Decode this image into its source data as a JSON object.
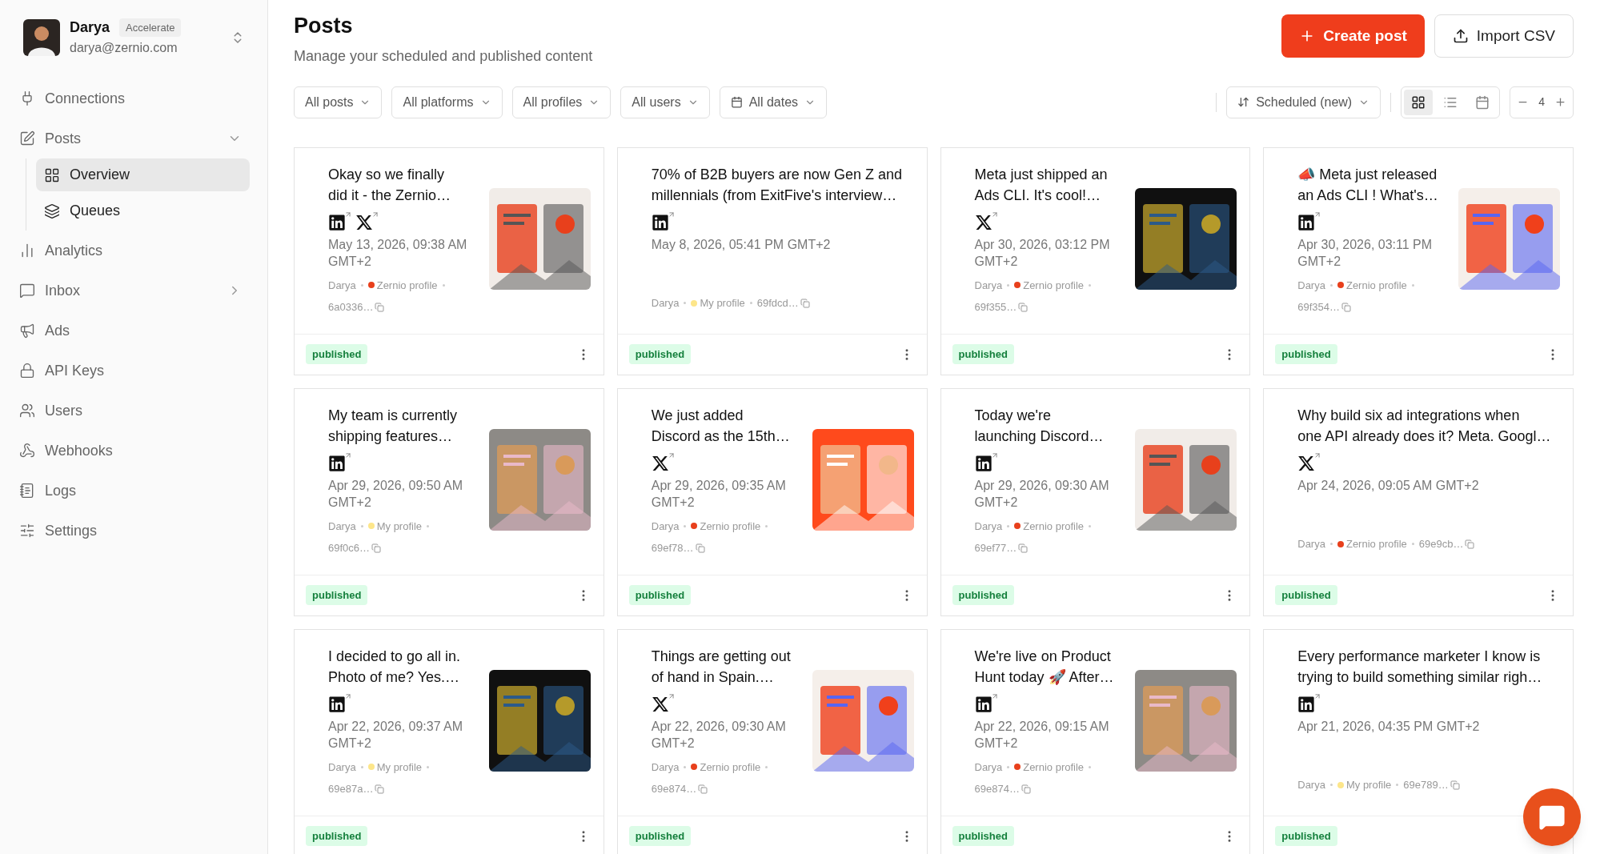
{
  "account": {
    "name": "Darya",
    "plan": "Accelerate",
    "email": "darya@zernio.com"
  },
  "sidebar": {
    "items": [
      {
        "kind": "link",
        "label": "Connections",
        "selected": false
      },
      {
        "kind": "group",
        "label": "Posts",
        "selected": false,
        "expanded": true,
        "children": [
          {
            "label": "Overview",
            "selected": true
          },
          {
            "label": "Queues",
            "selected": false
          }
        ]
      },
      {
        "kind": "link",
        "label": "Analytics",
        "selected": false
      },
      {
        "kind": "group",
        "label": "Inbox",
        "selected": false,
        "expanded": false
      },
      {
        "kind": "link",
        "label": "Ads",
        "selected": false
      },
      {
        "kind": "link",
        "label": "API Keys",
        "selected": false
      },
      {
        "kind": "link",
        "label": "Users",
        "selected": false
      },
      {
        "kind": "link",
        "label": "Webhooks",
        "selected": false
      },
      {
        "kind": "link",
        "label": "Logs",
        "selected": false
      },
      {
        "kind": "link",
        "label": "Settings",
        "selected": false
      }
    ]
  },
  "header": {
    "title": "Posts",
    "subtitle": "Manage your scheduled and published content",
    "primary_button": "Create post",
    "secondary_button": "Import CSV"
  },
  "filters": [
    {
      "kind": "plain",
      "label": "All posts"
    },
    {
      "kind": "plain",
      "label": "All platforms"
    },
    {
      "kind": "plain",
      "label": "All profiles"
    },
    {
      "kind": "plain",
      "label": "All users"
    },
    {
      "kind": "date",
      "label": "All dates"
    }
  ],
  "sort": {
    "label": "Scheduled (new)"
  },
  "views": [
    {
      "kind": "grid",
      "selected": true
    },
    {
      "kind": "list",
      "selected": false
    },
    {
      "kind": "calendar",
      "selected": false
    }
  ],
  "columns": {
    "value": "4"
  },
  "posts": [
    {
      "title": "Okay so we finally\ndid it - the Zernio…",
      "platforms": [
        {
          "kind": "linkedin"
        },
        {
          "kind": "x"
        }
      ],
      "date": "May 13, 2026, 09:38 AM GMT+2",
      "user": "Darya",
      "profile": "Zernio profile",
      "color": "#e8401c",
      "id": "6a0336…",
      "thumbnail": {
        "kind": "picture"
      },
      "status": "published"
    },
    {
      "title": "70% of B2B buyers are now Gen Z and\nmillennials (from ExitFive's interview…",
      "platforms": [
        {
          "kind": "linkedin"
        }
      ],
      "date": "May 8, 2026, 05:41 PM GMT+2",
      "user": "Darya",
      "profile": "My profile",
      "color": "#fde68a",
      "id": "69fdcd…",
      "status": "published"
    },
    {
      "title": "Meta just shipped an\nAds CLI. It's cool!…",
      "platforms": [
        {
          "kind": "x"
        }
      ],
      "date": "Apr 30, 2026, 03:12 PM GMT+2",
      "user": "Darya",
      "profile": "Zernio profile",
      "color": "#e8401c",
      "id": "69f355…",
      "thumbnail": {
        "kind": "picture"
      },
      "status": "published"
    },
    {
      "title": "📣 Meta just released\nan Ads CLI ! What's…",
      "platforms": [
        {
          "kind": "linkedin"
        }
      ],
      "date": "Apr 30, 2026, 03:11 PM GMT+2",
      "user": "Darya",
      "profile": "Zernio profile",
      "color": "#e8401c",
      "id": "69f354…",
      "thumbnail": {
        "kind": "picture"
      },
      "status": "published"
    },
    {
      "title": "My team is currently\nshipping features…",
      "platforms": [
        {
          "kind": "linkedin"
        }
      ],
      "date": "Apr 29, 2026, 09:50 AM GMT+2",
      "user": "Darya",
      "profile": "My profile",
      "color": "#fde68a",
      "id": "69f0c6…",
      "thumbnail": {
        "kind": "picture"
      },
      "status": "published"
    },
    {
      "title": "We just added\nDiscord as the 15th…",
      "platforms": [
        {
          "kind": "x"
        }
      ],
      "date": "Apr 29, 2026, 09:35 AM GMT+2",
      "user": "Darya",
      "profile": "Zernio profile",
      "color": "#e8401c",
      "id": "69ef78…",
      "thumbnail": {
        "kind": "picture"
      },
      "status": "published"
    },
    {
      "title": "Today we're\nlaunching Discord…",
      "platforms": [
        {
          "kind": "linkedin"
        }
      ],
      "date": "Apr 29, 2026, 09:30 AM GMT+2",
      "user": "Darya",
      "profile": "Zernio profile",
      "color": "#e8401c",
      "id": "69ef77…",
      "thumbnail": {
        "kind": "picture"
      },
      "status": "published"
    },
    {
      "title": "Why build six ad integrations when\none API already does it? Meta. Googl…",
      "platforms": [
        {
          "kind": "x"
        }
      ],
      "date": "Apr 24, 2026, 09:05 AM GMT+2",
      "user": "Darya",
      "profile": "Zernio profile",
      "color": "#e8401c",
      "id": "69e9cb…",
      "status": "published"
    },
    {
      "title": "I decided to go all in.\nPhoto of me? Yes.…",
      "platforms": [
        {
          "kind": "linkedin"
        }
      ],
      "date": "Apr 22, 2026, 09:37 AM GMT+2",
      "user": "Darya",
      "profile": "My profile",
      "color": "#fde68a",
      "id": "69e87a…",
      "thumbnail": {
        "kind": "picture"
      },
      "status": "published"
    },
    {
      "title": "Things are getting out\nof hand in Spain.…",
      "platforms": [
        {
          "kind": "x"
        }
      ],
      "date": "Apr 22, 2026, 09:30 AM GMT+2",
      "user": "Darya",
      "profile": "Zernio profile",
      "color": "#e8401c",
      "id": "69e874…",
      "thumbnail": {
        "kind": "picture"
      },
      "status": "published"
    },
    {
      "title": "We're live on Product\nHunt today 🚀 After…",
      "platforms": [
        {
          "kind": "linkedin"
        }
      ],
      "date": "Apr 22, 2026, 09:15 AM GMT+2",
      "user": "Darya",
      "profile": "Zernio profile",
      "color": "#e8401c",
      "id": "69e874…",
      "thumbnail": {
        "kind": "picture"
      },
      "status": "published"
    },
    {
      "title": "Every performance marketer I know is\ntrying to build something similar righ…",
      "platforms": [
        {
          "kind": "linkedin"
        }
      ],
      "date": "Apr 21, 2026, 04:35 PM GMT+2",
      "user": "Darya",
      "profile": "My profile",
      "color": "#fde68a",
      "id": "69e789…",
      "status": "published"
    }
  ]
}
